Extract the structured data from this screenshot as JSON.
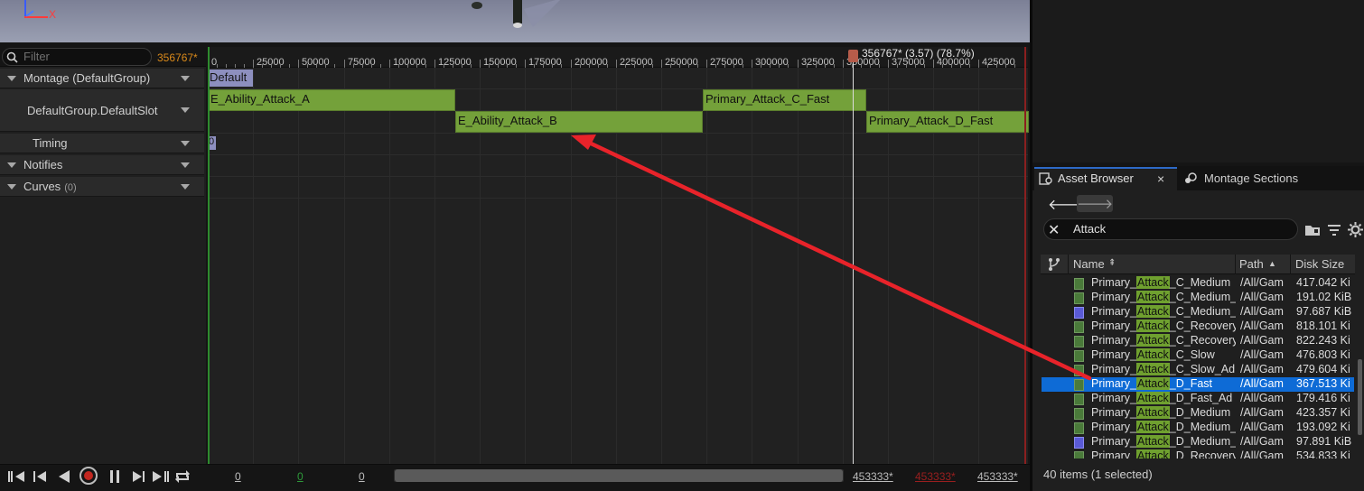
{
  "viewport": {
    "axis_label": "X"
  },
  "left_panel": {
    "filter_placeholder": "Filter",
    "filter_time": "356767*",
    "tracks": {
      "montage": "Montage (DefaultGroup)",
      "slot": "DefaultGroup.DefaultSlot",
      "timing": "Timing",
      "notifies": "Notifies",
      "curves": "Curves",
      "curves_count": "(0)"
    }
  },
  "timeline": {
    "ruler": [
      "0",
      "25000",
      "50000",
      "75000",
      "100000",
      "125000",
      "150000",
      "175000",
      "200000",
      "225000",
      "250000",
      "275000",
      "300000",
      "325000",
      "350000",
      "375000",
      "400000",
      "425000"
    ],
    "playhead_label": "356767* (3.57) (78.7%)",
    "section_label": "Default",
    "timing_label": "0",
    "segments": {
      "a": "E_Ability_Attack_A",
      "b": "E_Ability_Attack_B",
      "c": "Primary_Attack_C_Fast",
      "d": "Primary_Attack_D_Fast"
    }
  },
  "transport": {
    "field1": "0",
    "field2": "0",
    "field3": "0",
    "end1": "453333*",
    "end2": "453333*",
    "end3": "453333*"
  },
  "asset_browser": {
    "tab_label": "Asset Browser",
    "tab2_label": "Montage Sections",
    "search_value": "Attack",
    "columns": {
      "name": "Name",
      "path": "Path",
      "size": "Disk Size"
    },
    "rows": [
      {
        "pre": "Primary_",
        "hl": "Attack",
        "post": "_C_Medium",
        "path": "/All/Gam",
        "size": "417.042 Ki",
        "type": "anim"
      },
      {
        "pre": "Primary_",
        "hl": "Attack",
        "post": "_C_Medium_",
        "path": "/All/Gam",
        "size": "191.02 KiB",
        "type": "anim"
      },
      {
        "pre": "Primary_",
        "hl": "Attack",
        "post": "_C_Medium_",
        "path": "/All/Gam",
        "size": "97.687 KiB",
        "type": "other"
      },
      {
        "pre": "Primary_",
        "hl": "Attack",
        "post": "_C_Recovery",
        "path": "/All/Gam",
        "size": "818.101 Ki",
        "type": "anim"
      },
      {
        "pre": "Primary_",
        "hl": "Attack",
        "post": "_C_Recovery",
        "path": "/All/Gam",
        "size": "822.243 Ki",
        "type": "anim"
      },
      {
        "pre": "Primary_",
        "hl": "Attack",
        "post": "_C_Slow",
        "path": "/All/Gam",
        "size": "476.803 Ki",
        "type": "anim"
      },
      {
        "pre": "Primary_",
        "hl": "Attack",
        "post": "_C_Slow_Ad",
        "path": "/All/Gam",
        "size": "479.604 Ki",
        "type": "anim"
      },
      {
        "pre": "Primary_",
        "hl": "Attack",
        "post": "_D_Fast",
        "path": "/All/Gam",
        "size": "367.513 Ki",
        "type": "anim",
        "selected": true
      },
      {
        "pre": "Primary_",
        "hl": "Attack",
        "post": "_D_Fast_Ad",
        "path": "/All/Gam",
        "size": "179.416 Ki",
        "type": "anim"
      },
      {
        "pre": "Primary_",
        "hl": "Attack",
        "post": "_D_Medium",
        "path": "/All/Gam",
        "size": "423.357 Ki",
        "type": "anim"
      },
      {
        "pre": "Primary_",
        "hl": "Attack",
        "post": "_D_Medium_",
        "path": "/All/Gam",
        "size": "193.092 Ki",
        "type": "anim"
      },
      {
        "pre": "Primary_",
        "hl": "Attack",
        "post": "_D_Medium_",
        "path": "/All/Gam",
        "size": "97.891 KiB",
        "type": "other"
      },
      {
        "pre": "Primary_",
        "hl": "Attack",
        "post": "_D_Recovery",
        "path": "/All/Gam",
        "size": "534.833 Ki",
        "type": "anim"
      }
    ],
    "status": "40 items (1 selected)"
  },
  "colors": {
    "segment": "#74a13a",
    "selection": "#0e6bd6",
    "arrow": "#e8232a",
    "accent_time": "#d9891a"
  }
}
